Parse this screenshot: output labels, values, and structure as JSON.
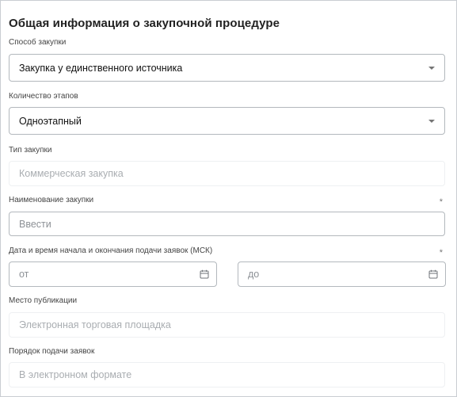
{
  "form": {
    "title": "Общая информация о закупочной процедуре",
    "method": {
      "label": "Способ закупки",
      "value": "Закупка у единственного источника"
    },
    "stages": {
      "label": "Количество этапов",
      "value": "Одноэтапный"
    },
    "type": {
      "label": "Тип закупки",
      "value": "Коммерческая закупка"
    },
    "name": {
      "label": "Наименование закупки",
      "placeholder": "Ввести",
      "required_mark": "*"
    },
    "dates": {
      "label": "Дата и время начала и окончания подачи заявок (МСК)",
      "required_mark": "*",
      "from_placeholder": "от",
      "to_placeholder": "до"
    },
    "publication": {
      "label": "Место публикации",
      "value": "Электронная торговая площадка"
    },
    "submission": {
      "label": "Порядок подачи заявок",
      "value": "В электронном формате"
    }
  },
  "icons": {
    "select_caret": "chevron-down-icon",
    "date": "calendar-icon"
  }
}
